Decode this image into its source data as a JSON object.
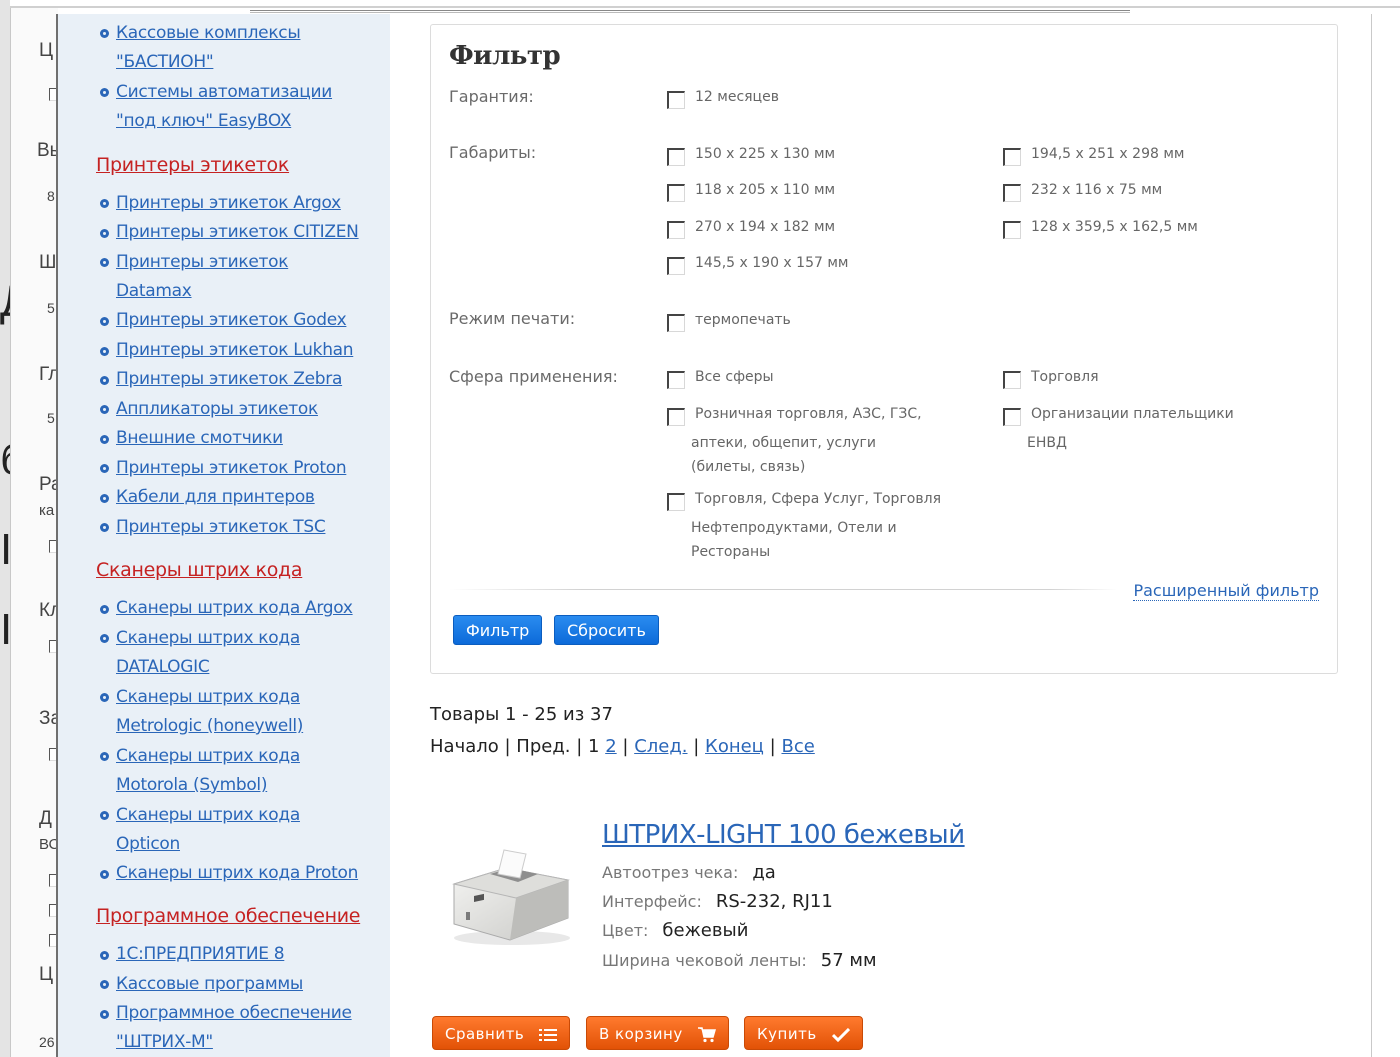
{
  "background": {
    "slide_text": [
      "Д",
      "б",
      "І",
      "І"
    ],
    "fragments": [
      "Ц",
      "Вы",
      "8",
      "Ш",
      "5",
      "Гл",
      "5",
      "Ра",
      "ка",
      "Кл",
      "За",
      "Д",
      "ВС",
      "Ц",
      "26"
    ]
  },
  "sidebar": {
    "group1_items": [
      "Кассовые комплексы",
      "\"БАСТИОН\"",
      "Системы автоматизации",
      "\"под ключ\" EasyBOX"
    ],
    "categories": [
      {
        "title": "Принтеры этикеток",
        "items": [
          [
            "Принтеры этикеток Argox"
          ],
          [
            "Принтеры этикеток CITIZEN"
          ],
          [
            "Принтеры этикеток",
            "Datamax"
          ],
          [
            "Принтеры этикеток Godex"
          ],
          [
            "Принтеры этикеток Lukhan"
          ],
          [
            "Принтеры этикеток Zebra"
          ],
          [
            "Аппликаторы этикеток"
          ],
          [
            "Внешние смотчики"
          ],
          [
            "Принтеры этикеток Proton"
          ],
          [
            "Кабели для принтеров"
          ],
          [
            "Принтеры этикеток TSC"
          ]
        ]
      },
      {
        "title": "Сканеры штрих кода",
        "items": [
          [
            "Сканеры штрих кода Argox"
          ],
          [
            "Сканеры штрих кода",
            "DATALOGIC"
          ],
          [
            "Сканеры штрих кода",
            "Metrologic (honeywell)"
          ],
          [
            "Сканеры штрих кода",
            "Motorola (Symbol)"
          ],
          [
            "Сканеры штрих кода",
            "Opticon"
          ],
          [
            "Сканеры штрих кода Proton"
          ]
        ]
      },
      {
        "title": "Программное обеспечение",
        "items": [
          [
            "1С:ПРЕДПРИЯТИЕ 8"
          ],
          [
            "Кассовые программы"
          ],
          [
            "Программное обеспечение",
            "\"ШТРИХ-М\""
          ]
        ]
      }
    ]
  },
  "filter": {
    "title": "Фильтр",
    "warranty_label": "Гарантия:",
    "warranty_options": [
      "12 месяцев"
    ],
    "dims_label": "Габариты:",
    "dims_options": [
      "150 x 225 x 130 мм",
      "194,5 x 251 x 298 мм",
      "118 x 205 x 110 мм",
      "232 x 116 x 75 мм",
      "270 x 194 x 182 мм",
      "128 x 359,5 x 162,5 мм",
      "145,5 x 190 x 157 мм"
    ],
    "print_label": "Режим печати:",
    "print_options": [
      "термопечать"
    ],
    "sphere_label": "Сфера применения:",
    "sphere_options": {
      "all": "Все сферы",
      "trade": "Торговля",
      "retail": [
        "Розничная торговля, АЗС, ГЗС,",
        "аптеки, общепит, услуги",
        "(билеты, связь)"
      ],
      "envd": [
        "Организации плательщики",
        "ЕНВД"
      ],
      "services": [
        "Торговля, Сфера Услуг, Торговля",
        "Нефтепродуктами, Отели и",
        "Рестораны"
      ]
    },
    "advanced_link": "Расширенный фильтр",
    "apply_button": "Фильтр",
    "reset_button": "Сбросить"
  },
  "results": {
    "count_text": "Товары 1 - 25 из 37",
    "pagination": {
      "start": "Начало",
      "prev": "Пред.",
      "page1": "1",
      "page2": "2",
      "next": "След.",
      "end": "Конец",
      "all": "Все"
    }
  },
  "product": {
    "title": "ШТРИХ-LIGHT 100 бежевый",
    "specs": [
      {
        "label": "Автоотрез чека:",
        "value": "да"
      },
      {
        "label": "Интерфейс:",
        "value": "RS-232, RJ11"
      },
      {
        "label": "Цвет:",
        "value": "бежевый"
      },
      {
        "label": "Ширина чековой ленты:",
        "value": "57 мм"
      }
    ],
    "compare_button": "Сравнить",
    "cart_button": "В корзину",
    "buy_button": "Купить",
    "icons": {
      "compare": "list-icon",
      "cart": "cart-icon",
      "buy": "checkmark-icon"
    }
  }
}
